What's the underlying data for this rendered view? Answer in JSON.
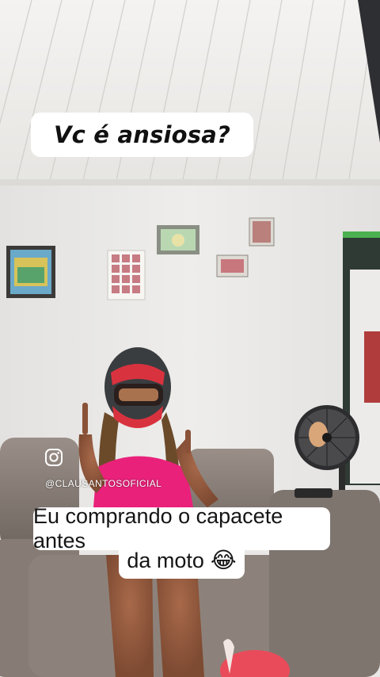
{
  "caption_top": {
    "text": "Vc é ansiosa?"
  },
  "caption_bottom": {
    "line1": "Eu comprando o capacete antes",
    "line2": "da moto",
    "emoji": "😂"
  },
  "watermark": {
    "icon": "instagram-icon",
    "handle": "@CLAUSANTOSOFICIAL"
  },
  "colors": {
    "ceiling": "#f2f1ee",
    "wall": "#e8e7e5",
    "sofa": "#8a8079",
    "top": "#e9217a",
    "helmet": "#3a3d40",
    "caption_bg": "#ffffff"
  }
}
